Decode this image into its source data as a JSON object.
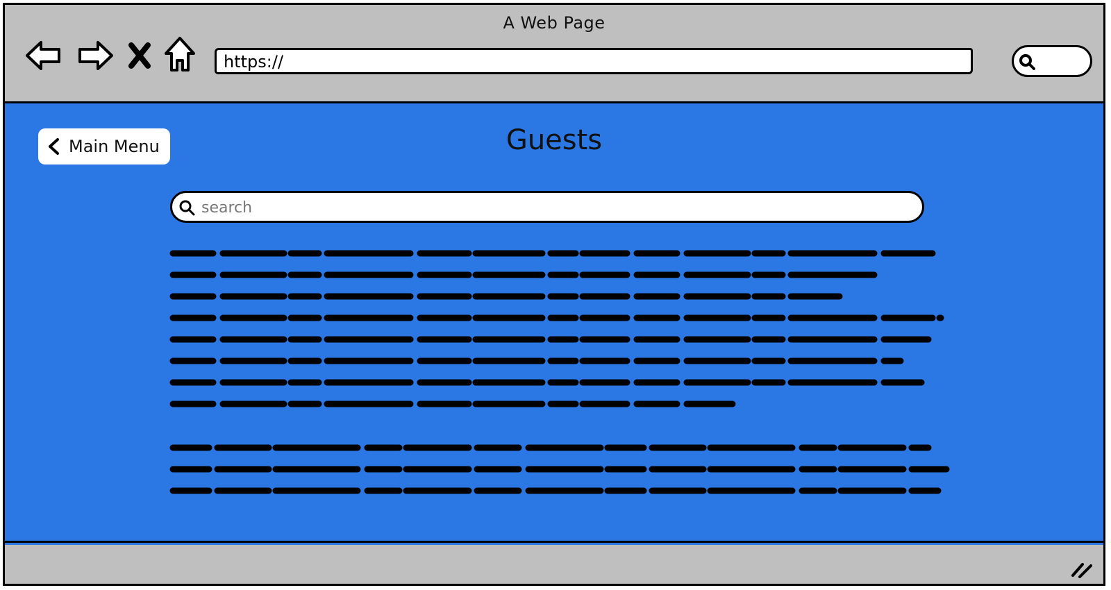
{
  "window": {
    "title": "A Web Page"
  },
  "toolbar": {
    "back_icon": "arrow-left-icon",
    "forward_icon": "arrow-right-icon",
    "stop_icon": "close-icon",
    "home_icon": "home-icon",
    "url": "https://"
  },
  "page": {
    "back_button_label": "Main Menu",
    "title": "Guests",
    "search_placeholder": "search"
  },
  "colors": {
    "content_background": "#2b78e4",
    "chrome_background": "#bfbfbf"
  }
}
